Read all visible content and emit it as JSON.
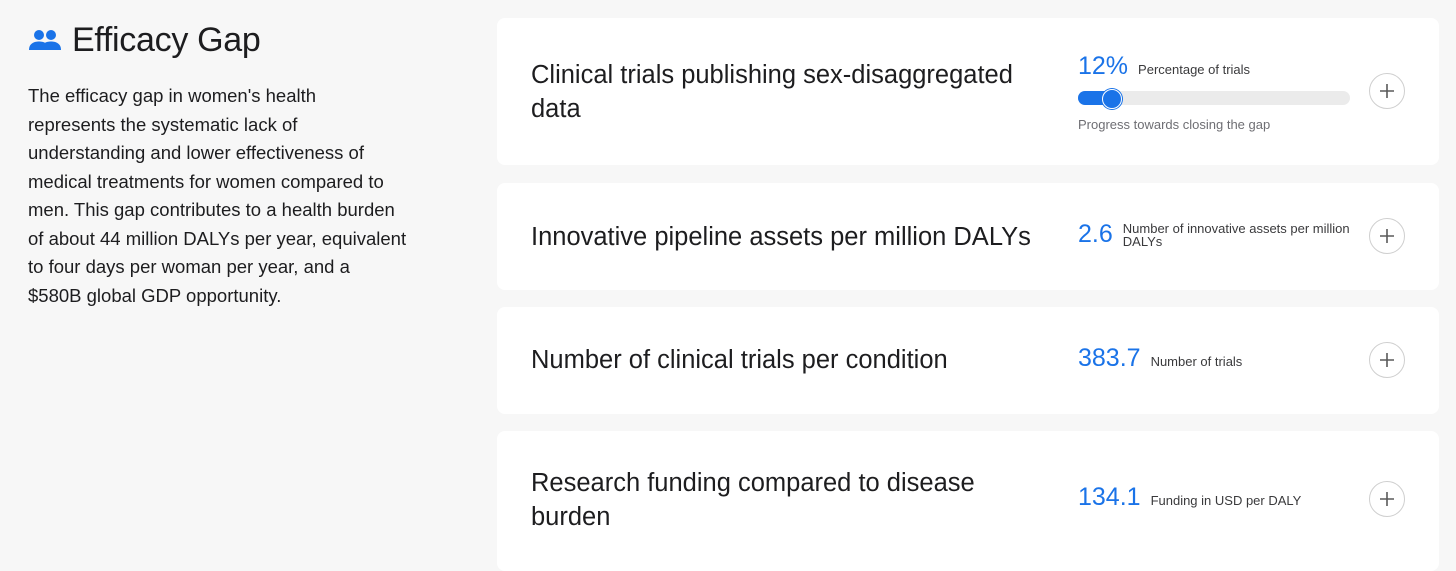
{
  "section": {
    "icon": "people-icon",
    "title": "Efficacy Gap",
    "description": "The efficacy gap in women's health represents the systematic lack of understanding and lower effectiveness of medical treatments for women compared to men. This gap contributes to a health burden of about 44 million DALYs per year, equivalent to four days per woman per year, and a $580B global GDP opportunity."
  },
  "colors": {
    "accent": "#1a73e8",
    "card_background": "#ffffff",
    "page_background": "#f7f7f7"
  },
  "metrics": [
    {
      "title": "Clinical trials publishing sex-disaggregated data",
      "value": "12%",
      "label": "Percentage of trials",
      "progress_fraction": 0.12,
      "progress_caption": "Progress towards closing the gap",
      "expand_icon": "plus-icon"
    },
    {
      "title": "Innovative pipeline assets per million DALYs",
      "value": "2.6",
      "label": "Number of innovative assets per million DALYs",
      "expand_icon": "plus-icon"
    },
    {
      "title": "Number of clinical trials per condition",
      "value": "383.7",
      "label": "Number of trials",
      "expand_icon": "plus-icon"
    },
    {
      "title": "Research funding compared to disease burden",
      "value": "134.1",
      "label": "Funding in USD per DALY",
      "expand_icon": "plus-icon"
    }
  ]
}
